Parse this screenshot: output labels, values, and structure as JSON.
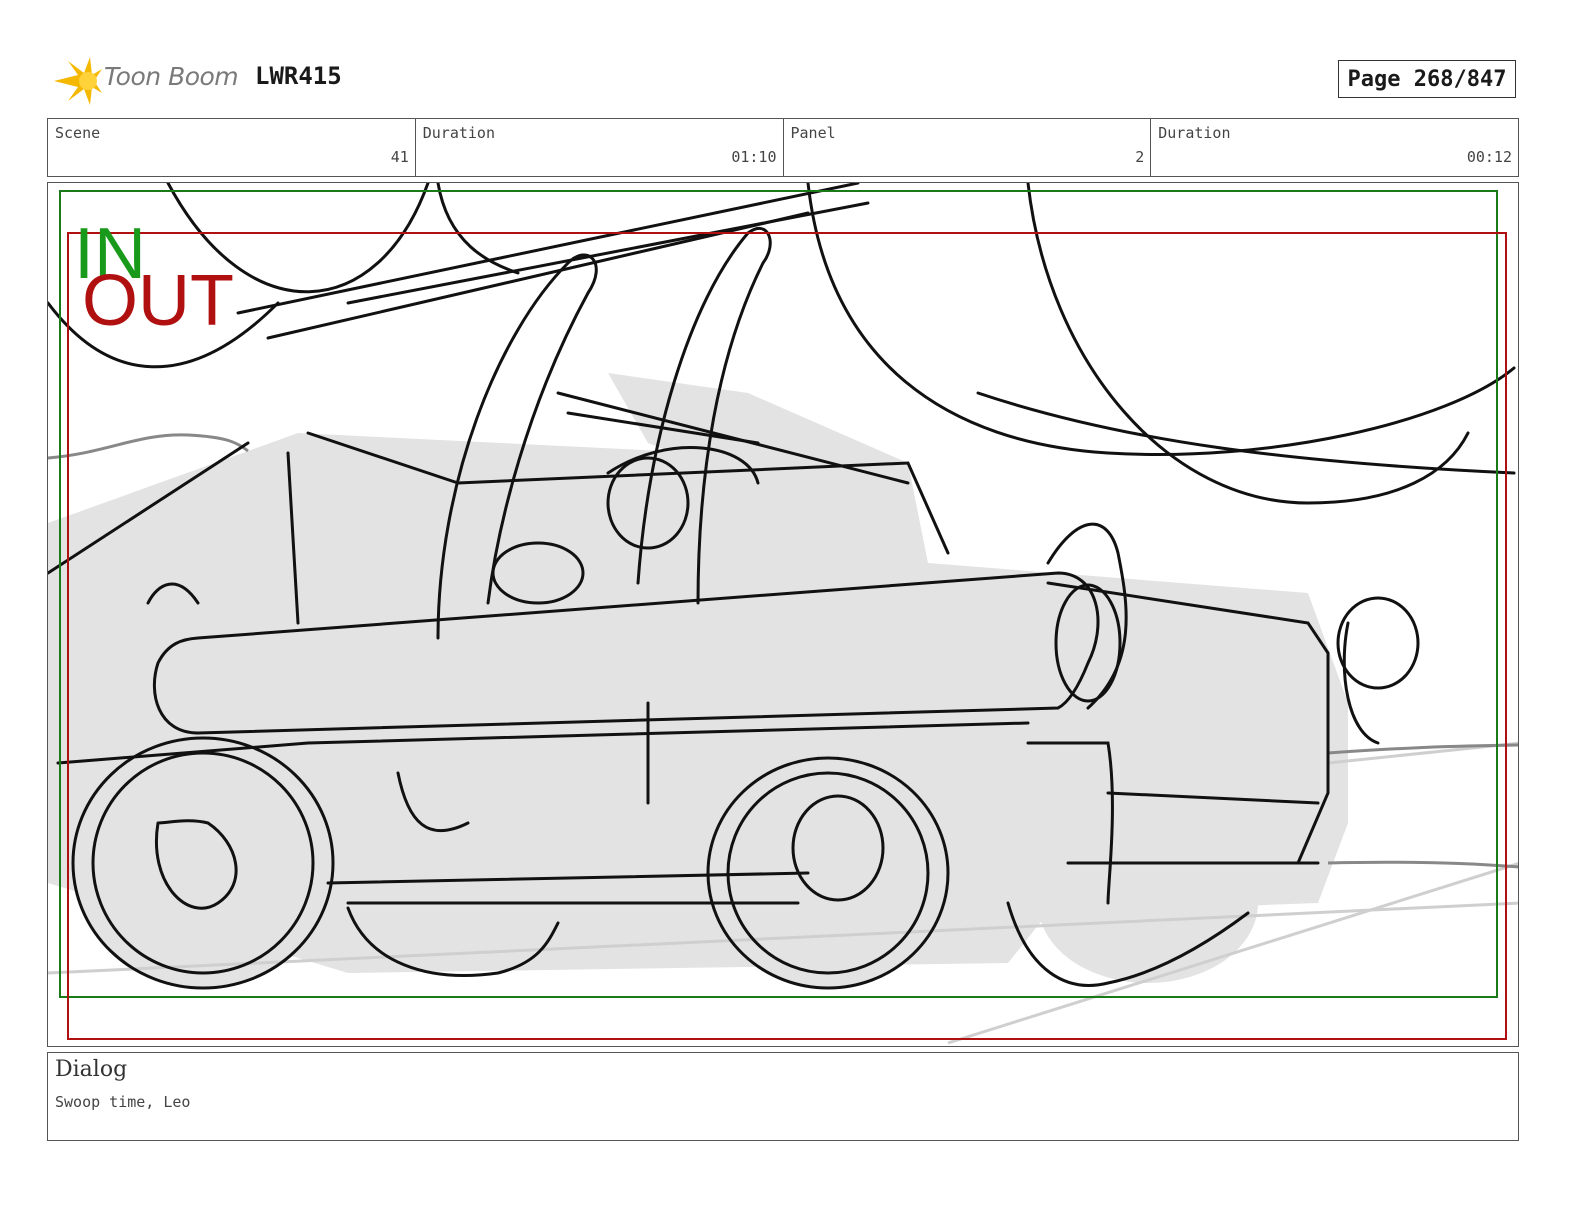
{
  "header": {
    "logo_name": "Toon Boom",
    "project": "LWR415",
    "page_label": "Page 268/847"
  },
  "info": {
    "scene_label": "Scene",
    "scene_value": "41",
    "scene_duration_label": "Duration",
    "scene_duration_value": "01:10",
    "panel_label": "Panel",
    "panel_value": "2",
    "panel_duration_label": "Duration",
    "panel_duration_value": "00:12"
  },
  "frame": {
    "in_label": "IN",
    "out_label": "OUT",
    "in_color": "#1a9a1a",
    "out_color": "#b01010"
  },
  "dialog": {
    "title": "Dialog",
    "text": "Swoop time, Leo"
  }
}
